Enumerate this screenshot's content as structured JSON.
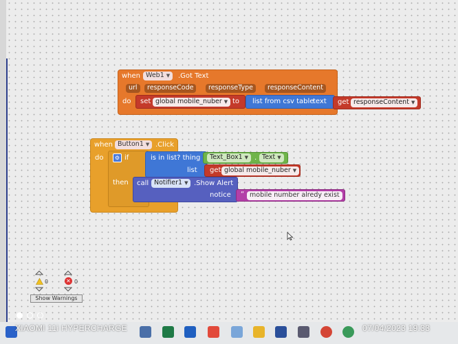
{
  "web_event": {
    "when": "when",
    "component": "Web1",
    "event": ".Got Text",
    "params": [
      "url",
      "responseCode",
      "responseType",
      "responseContent"
    ],
    "do": "do",
    "set": "set",
    "variable": "global mobile_nuber",
    "to": "to",
    "list_from_csv": "list from csv table",
    "text": "text",
    "get": "get",
    "get_var": "responseContent"
  },
  "button_event": {
    "when": "when",
    "component": "Button1",
    "event": ".Click",
    "do": "do",
    "if": "if",
    "is_in_list": "is in list? thing",
    "textbox": "Text_Box1",
    "text_prop": "Text",
    "list": "list",
    "get": "get",
    "get_var": "global mobile_nuber",
    "then": "then",
    "call": "call",
    "notifier": "Notifier1",
    "method": ".Show Alert",
    "notice": "notice",
    "message": "mobile number alredy exist"
  },
  "warnings": {
    "warn_count": "0",
    "error_count": "0",
    "button": "Show Warnings"
  },
  "watermark": {
    "device": "XIAOMI 11i HYPERCHARGE",
    "timestamp": "07/04/2023  19:33"
  },
  "colors": {
    "event_orange": "#e6782b",
    "control_gold": "#e8a02b",
    "variable_red": "#c43a2a",
    "list_blue": "#3f77d6",
    "component_green": "#6fb44a",
    "method_purple": "#5660bf",
    "text_magenta": "#b33fa8"
  }
}
